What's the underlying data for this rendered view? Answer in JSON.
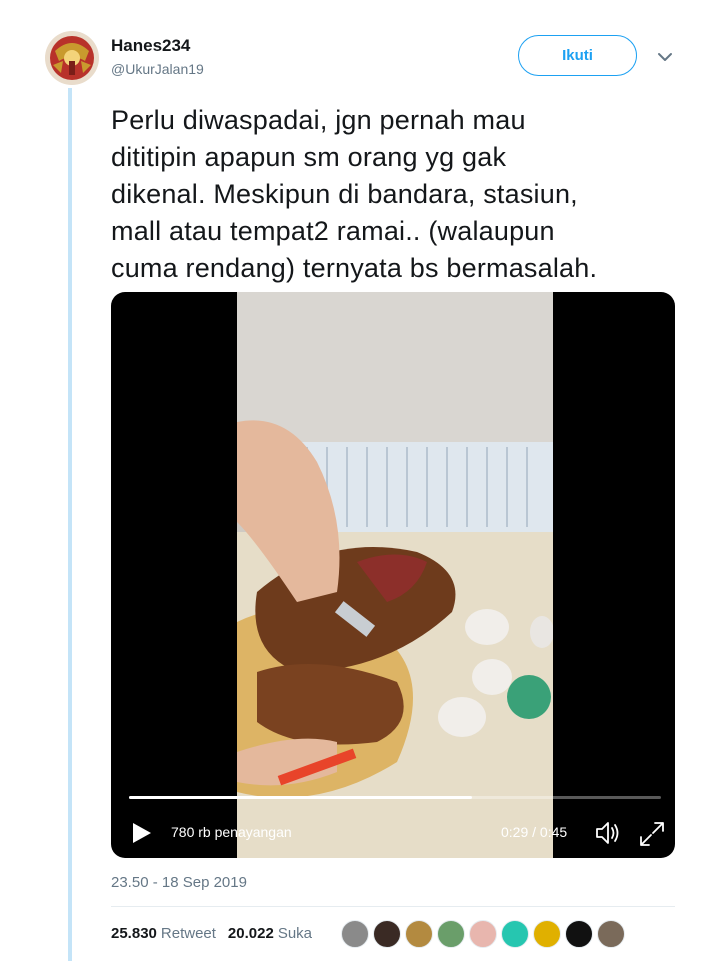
{
  "user": {
    "display_name": "Hanes234",
    "handle": "@UkurJalan19"
  },
  "follow_label": "Ikuti",
  "tweet_text": "Perlu diwaspadai, jgn pernah mau\ndititipin apapun sm orang yg gak\ndikenal.  Meskipun di bandara, stasiun,\nmall atau tempat2 ramai.. (walaupun\ncuma rendang) ternyata bs bermasalah.",
  "video": {
    "views": "780 rb penayangan",
    "time": "0:29 / 0:45",
    "progress": 0.644
  },
  "timestamp": "23.50 - 18 Sep 2019",
  "stats": {
    "retweets": "25.830",
    "retweet_label": "Retweet",
    "likes": "20.022",
    "like_label": "Suka"
  },
  "colors": {
    "accent": "#1da1f2",
    "thread_line": "#c4e4f8",
    "muted": "#657786"
  },
  "liker_avatars": [
    {
      "name": "liker-avatar-1",
      "color": "#8a8a8a"
    },
    {
      "name": "liker-avatar-2",
      "color": "#3a2a24"
    },
    {
      "name": "liker-avatar-3",
      "color": "#b38a40"
    },
    {
      "name": "liker-avatar-4",
      "color": "#6a9e6a"
    },
    {
      "name": "liker-avatar-5",
      "color": "#e8b6ae"
    },
    {
      "name": "liker-avatar-6",
      "color": "#26c6b0"
    },
    {
      "name": "liker-avatar-7",
      "color": "#e0b000"
    },
    {
      "name": "liker-avatar-8",
      "color": "#111111"
    },
    {
      "name": "liker-avatar-9",
      "color": "#7a6a5a"
    }
  ]
}
